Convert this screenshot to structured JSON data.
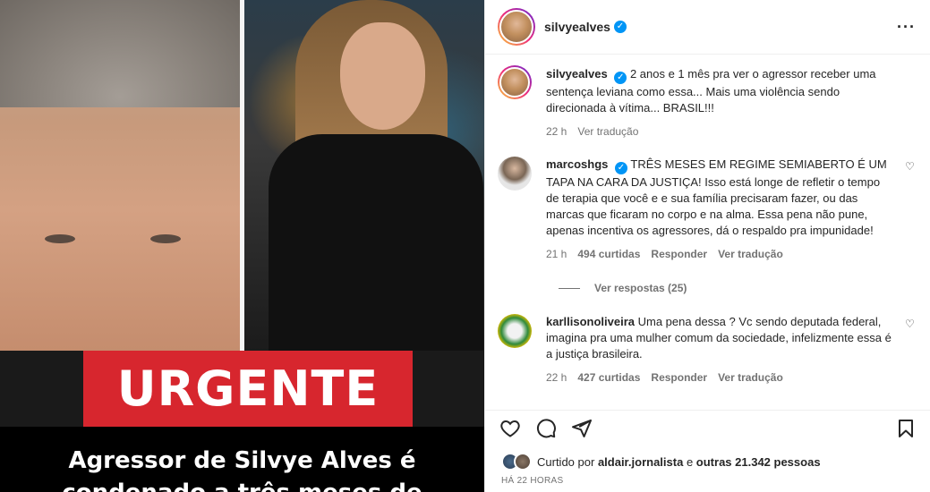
{
  "media": {
    "badge_text": "URGENTE",
    "headline_lines": [
      "Agressor de Silvye Alves é",
      "condenado a três meses de"
    ]
  },
  "header": {
    "username": "silvyealves",
    "more_icon": "more-horizontal-icon"
  },
  "caption": {
    "username": "silvyealves",
    "text": "2 anos e 1 mês pra ver o agressor receber uma sentença leviana como essa... Mais uma violência sendo direcionada à vítima... BRASIL!!!",
    "time": "22 h",
    "translate": "Ver tradução"
  },
  "comments": [
    {
      "username": "marcoshgs",
      "verified": true,
      "text": "TRÊS MESES EM REGIME SEMIABERTO É UM TAPA NA CARA DA JUSTIÇA! Isso está longe de refletir o tempo de terapia que você e e sua família precisaram fazer, ou das marcas que ficaram no corpo e na alma. Essa pena não pune, apenas incentiva os agressores, dá o respaldo pra impunidade!",
      "time": "21 h",
      "likes": "494 curtidas",
      "reply": "Responder",
      "translate": "Ver tradução",
      "view_replies": "Ver respostas (25)"
    },
    {
      "username": "karllisonoliveira",
      "verified": false,
      "text": "Uma pena dessa ? Vc sendo deputada federal, imagina pra uma mulher comum da sociedade, infelizmente essa é a justiça brasileira.",
      "time": "22 h",
      "likes": "427 curtidas",
      "reply": "Responder",
      "translate": "Ver tradução"
    }
  ],
  "liked_by": {
    "prefix": "Curtido por",
    "user": "aldair.jornalista",
    "joiner": "e",
    "others": "outras 21.342 pessoas"
  },
  "timestamp": "HÁ 22 HORAS",
  "colors": {
    "accent": "#0095f6",
    "urgent_red": "#d7262e",
    "muted": "#737373"
  }
}
